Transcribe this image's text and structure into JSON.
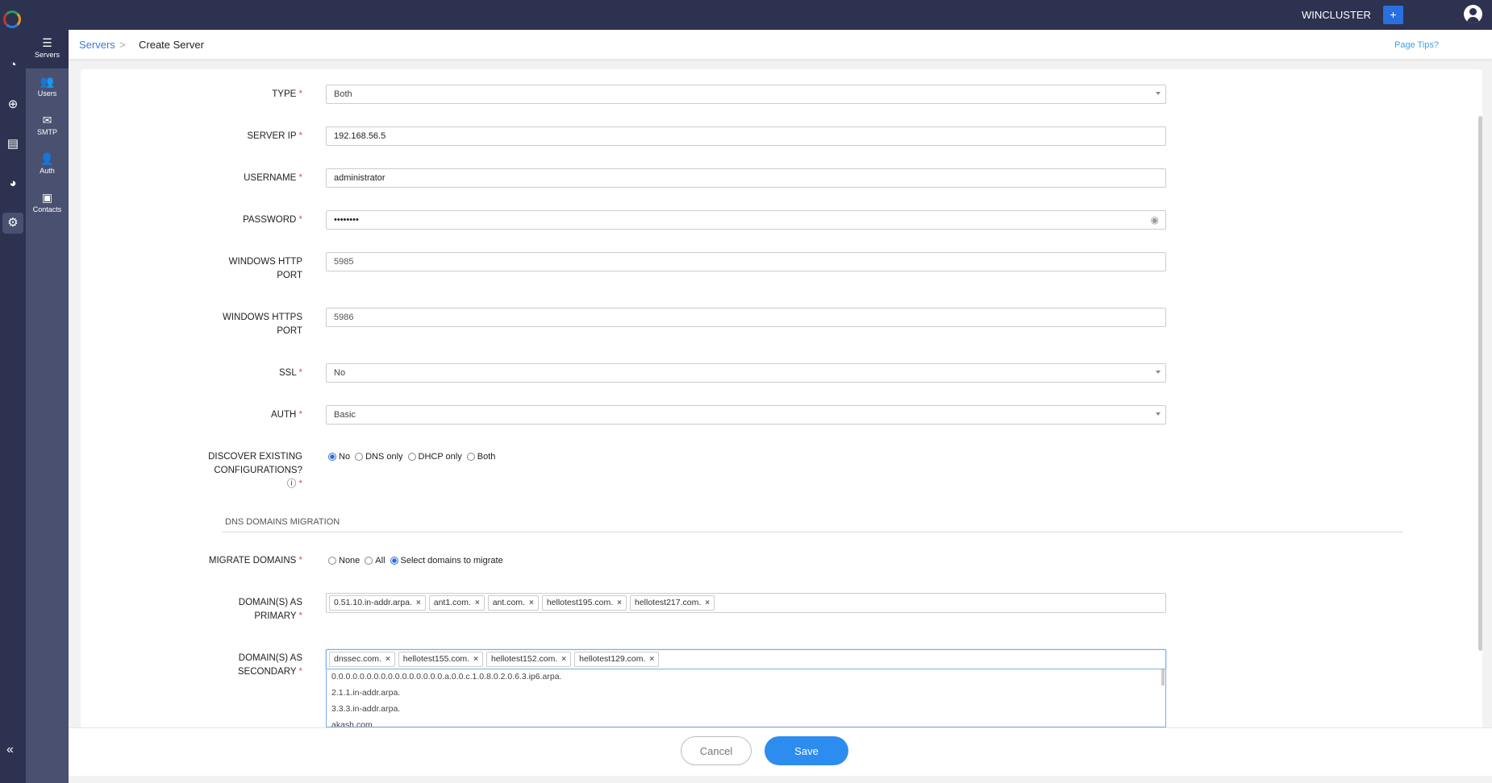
{
  "header": {
    "cluster": "WINCLUSTER",
    "add_label": "+"
  },
  "rail": {
    "icons": [
      "dashboard-icon",
      "dns-globe-icon",
      "dhcp-icon",
      "reports-icon",
      "settings-icon"
    ],
    "collapse": "«"
  },
  "sidebar": {
    "items": [
      {
        "label": "Servers",
        "icon": "☰"
      },
      {
        "label": "Users",
        "icon": "👥"
      },
      {
        "label": "SMTP",
        "icon": "✉"
      },
      {
        "label": "Auth",
        "icon": "👤"
      },
      {
        "label": "Contacts",
        "icon": "▣"
      }
    ]
  },
  "breadcrumb": {
    "parent": "Servers",
    "sep": ">",
    "current": "Create Server",
    "tips": "Page Tips?"
  },
  "form": {
    "type": {
      "label": "TYPE",
      "value": "Both"
    },
    "server_ip": {
      "label": "SERVER IP",
      "value": "192.168.56.5"
    },
    "username": {
      "label": "USERNAME",
      "value": "administrator"
    },
    "password": {
      "label": "PASSWORD",
      "value": "••••••••"
    },
    "http_port": {
      "label": "WINDOWS HTTP PORT",
      "value": "5985"
    },
    "https_port": {
      "label": "WINDOWS HTTPS PORT",
      "value": "5986"
    },
    "ssl": {
      "label": "SSL",
      "value": "No"
    },
    "auth": {
      "label": "AUTH",
      "value": "Basic"
    },
    "discover": {
      "label": "DISCOVER EXISTING CONFIGURATIONS?",
      "options": [
        "No",
        "DNS only",
        "DHCP only",
        "Both"
      ],
      "selected": "No"
    },
    "section": "DNS DOMAINS MIGRATION",
    "migrate": {
      "label": "MIGRATE DOMAINS",
      "options": [
        "None",
        "All",
        "Select domains to migrate"
      ],
      "selected": "Select domains to migrate"
    },
    "primary": {
      "label": "DOMAIN(S) AS PRIMARY",
      "tags": [
        "0.51.10.in-addr.arpa.",
        "ant1.com.",
        "ant.com.",
        "hellotest195.com.",
        "hellotest217.com."
      ]
    },
    "secondary": {
      "label": "DOMAIN(S) AS SECONDARY",
      "tags": [
        "dnssec.com.",
        "hellotest155.com.",
        "hellotest152.com.",
        "hellotest129.com."
      ],
      "options": [
        "0.0.0.0.0.0.0.0.0.0.0.0.0.0.0.0.a.0.0.c.1.0.8.0.2.0.6.3.ip6.arpa.",
        "2.1.1.in-addr.arpa.",
        "3.3.3.in-addr.arpa.",
        "akash.com."
      ]
    }
  },
  "footer": {
    "cancel": "Cancel",
    "save": "Save"
  },
  "req": "*"
}
